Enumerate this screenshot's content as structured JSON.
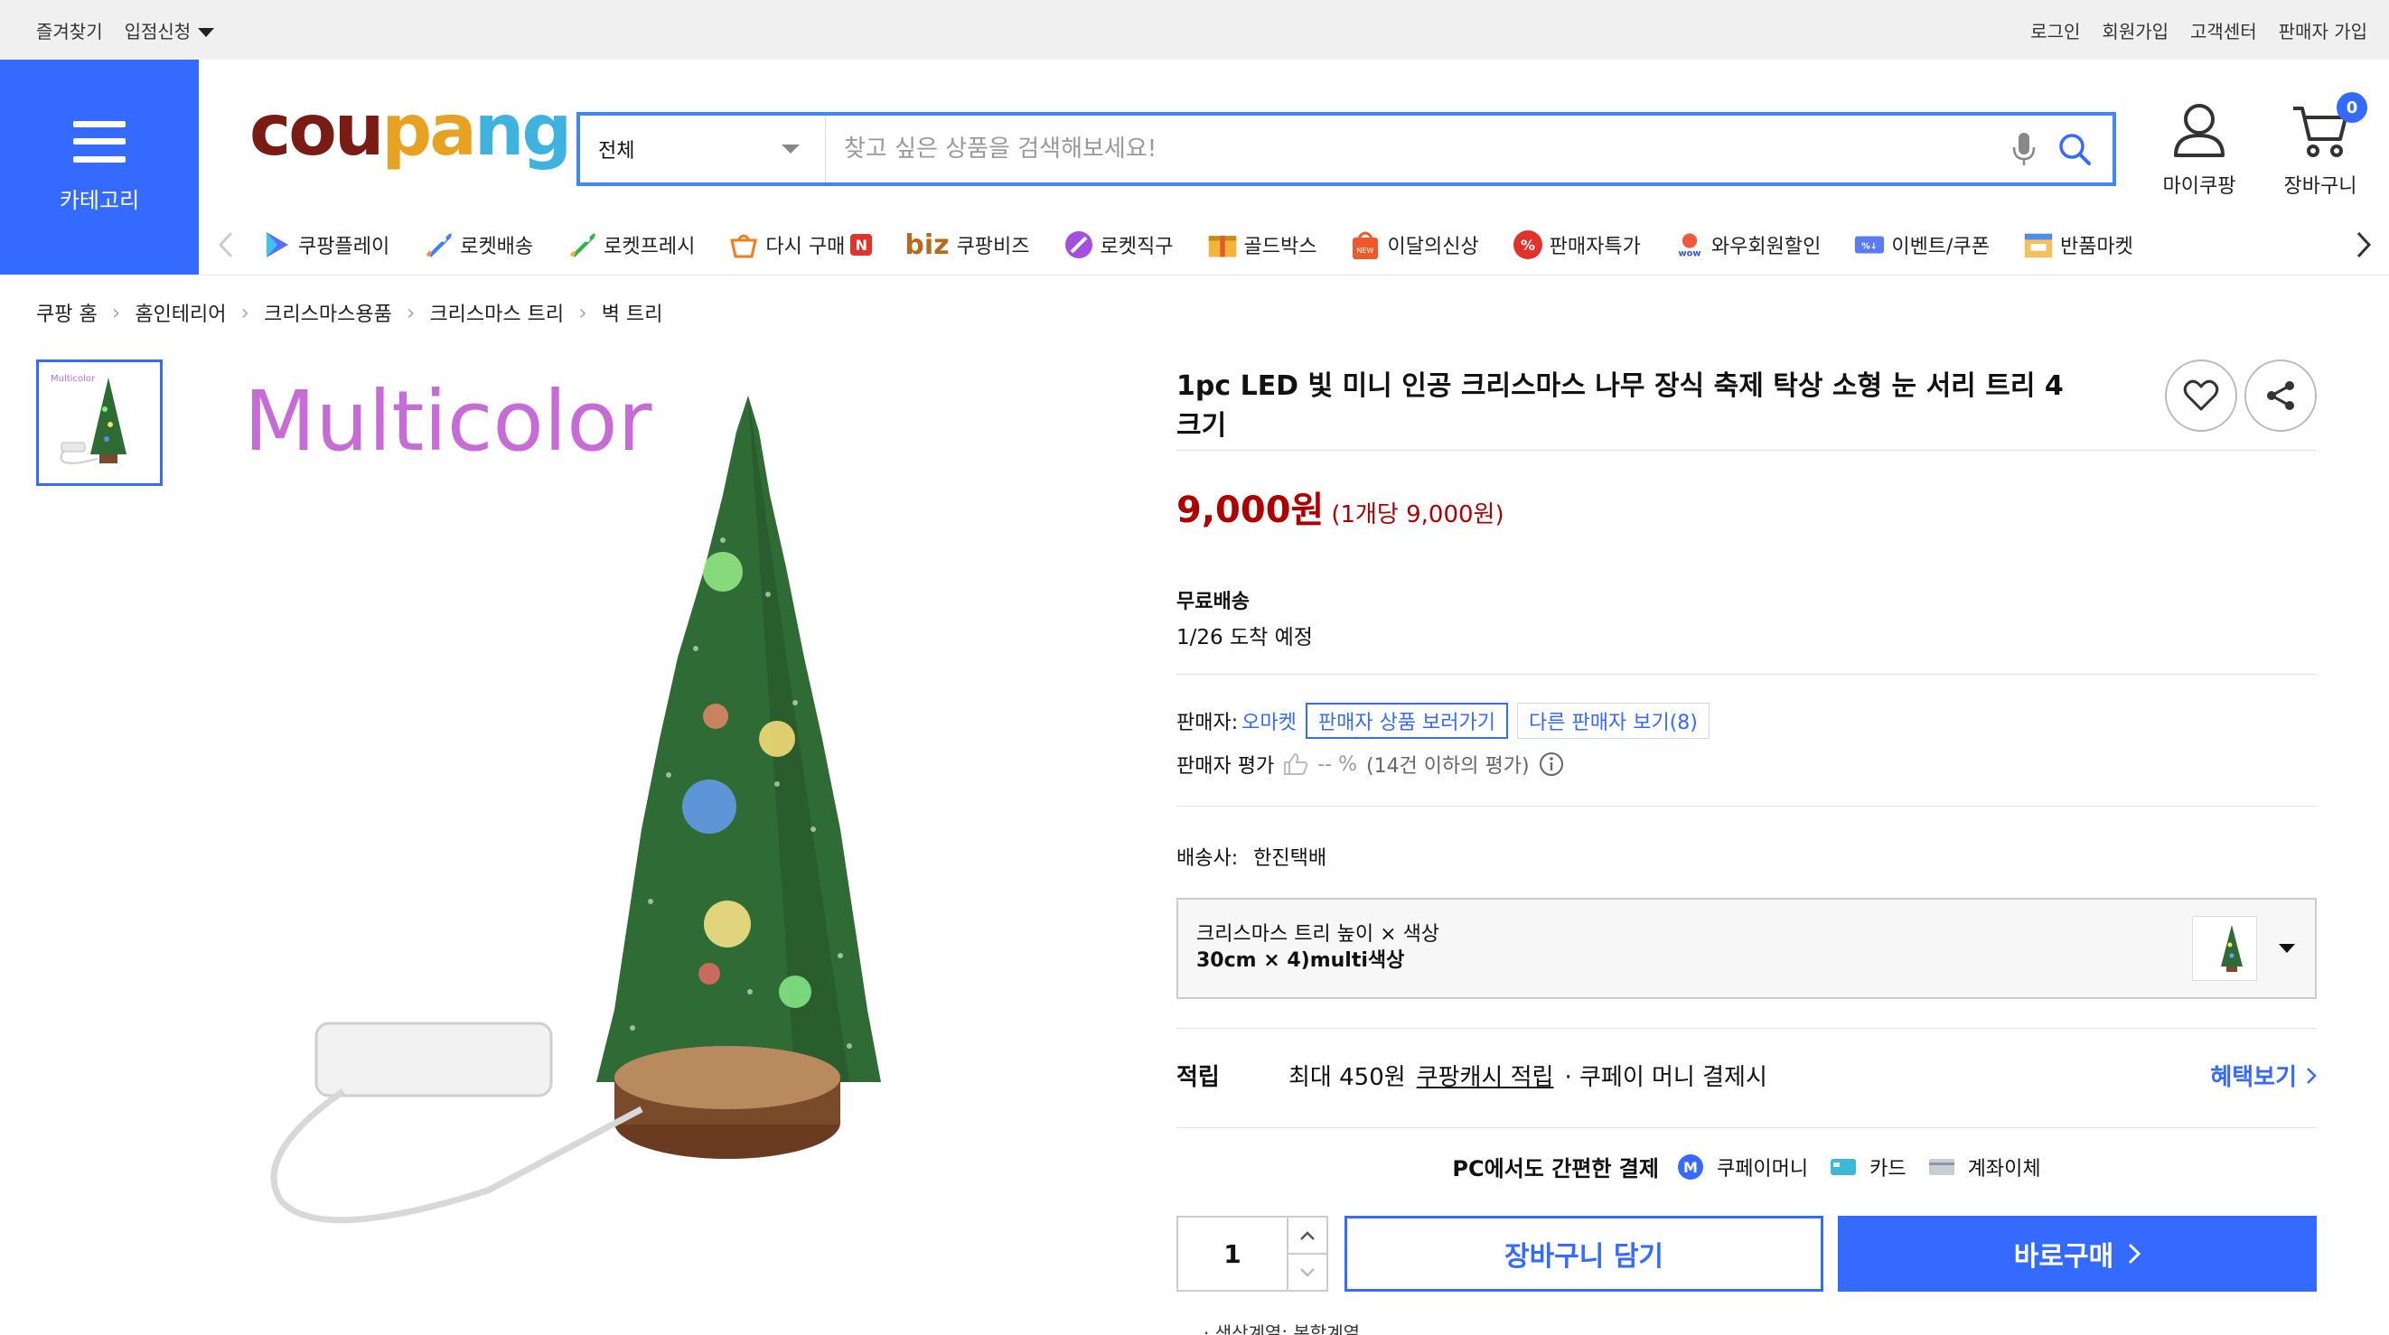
{
  "topbar": {
    "favorites": "즐겨찾기",
    "seller_join": "입점신청",
    "login": "로그인",
    "signup": "회원가입",
    "customer_center": "고객센터",
    "seller_signup": "판매자 가입"
  },
  "category": {
    "label": "카테고리"
  },
  "logo": {
    "letters": [
      "c",
      "o",
      "u",
      "p",
      "a",
      "n",
      "g"
    ],
    "colors": [
      "#7a1b14",
      "#7a1b14",
      "#7a1b14",
      "#e8a123",
      "#e8a123",
      "#3eb3e0",
      "#3eb3e0"
    ]
  },
  "search": {
    "scope": "전체",
    "placeholder": "찾고 싶은 상품을 검색해보세요!"
  },
  "header_icons": {
    "my_coupang": "마이쿠팡",
    "cart": "장바구니",
    "cart_count": "0"
  },
  "nav": {
    "items": [
      {
        "label": "쿠팡플레이",
        "icon": "play-icon"
      },
      {
        "label": "로켓배송",
        "icon": "rocket-icon"
      },
      {
        "label": "로켓프레시",
        "icon": "fresh-rocket-icon"
      },
      {
        "label": "다시 구매",
        "icon": "rebuy-icon",
        "badge": "N"
      },
      {
        "label": "쿠팡비즈",
        "prefix": "biz",
        "icon": "biz-icon"
      },
      {
        "label": "로켓직구",
        "icon": "global-rocket-icon"
      },
      {
        "label": "골드박스",
        "icon": "goldbox-icon"
      },
      {
        "label": "이달의신상",
        "icon": "new-bag-icon"
      },
      {
        "label": "판매자특가",
        "icon": "percent-icon"
      },
      {
        "label": "와우회원할인",
        "icon": "wow-icon"
      },
      {
        "label": "이벤트/쿠폰",
        "icon": "coupon-icon"
      },
      {
        "label": "반품마켓",
        "icon": "return-market-icon"
      }
    ]
  },
  "breadcrumb": [
    "쿠팡 홈",
    "홈인테리어",
    "크리스마스용품",
    "크리스마스 트리",
    "벽 트리"
  ],
  "gallery": {
    "hero_caption": "Multicolor"
  },
  "product": {
    "title": "1pc LED 빛 미니 인공 크리스마스 나무 장식 축제 탁상 소형 눈 서리 트리 4 크기",
    "price": "9,000원",
    "unit_price": "(1개당 9,000원)",
    "shipping_title": "무료배송",
    "delivery_date": "1/26 도착 예정",
    "seller_label": "판매자:",
    "seller_name": "오마켓",
    "seller_products_btn": "판매자 상품 보러가기",
    "other_sellers_btn": "다른 판매자 보기(8)",
    "seller_rating_label": "판매자 평가",
    "seller_rating_value": "-- %",
    "seller_rating_note": "(14건 이하의 평가)",
    "courier_label": "배송사:",
    "courier_name": "한진택배",
    "option_label": "크리스마스 트리 높이 × 색상",
    "option_value": "30cm × 4)multi색상",
    "reward_key": "적립",
    "reward_text": "최대 450원",
    "reward_link": "쿠팡캐시 적립",
    "reward_suffix": "· 쿠페이 머니 결제시",
    "reward_more": "혜택보기",
    "pay_title": "PC에서도 간편한 결제",
    "pay_methods": [
      "쿠페이머니",
      "카드",
      "계좌이체"
    ],
    "quantity": "1",
    "add_to_cart": "장바구니 담기",
    "buy_now": "바로구매",
    "footnote": "· 색상계열: 복합계열"
  },
  "colors": {
    "accent": "#346aff",
    "price": "#ae0000",
    "search_border": "#4285f4"
  }
}
